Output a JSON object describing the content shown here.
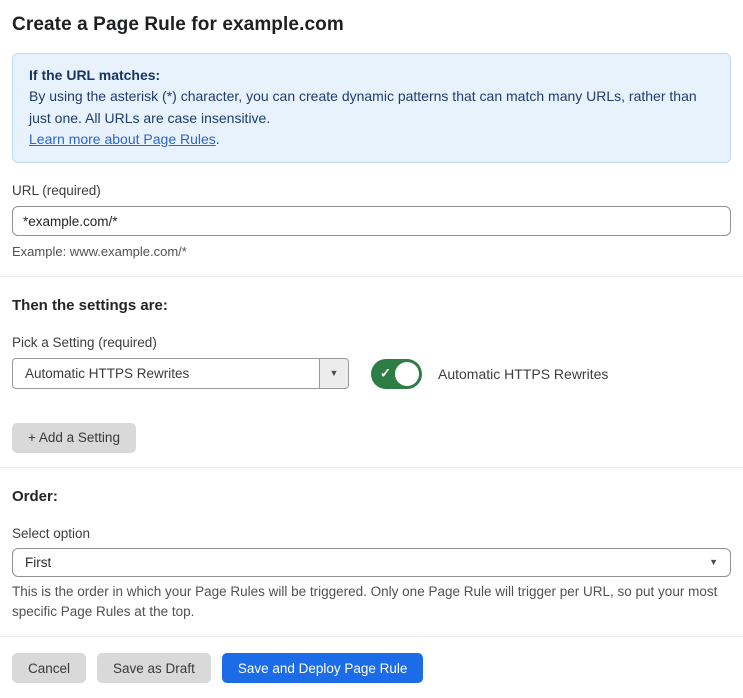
{
  "page": {
    "title": "Create a Page Rule for example.com"
  },
  "info_box": {
    "heading": "If the URL matches:",
    "body": "By using the asterisk (*) character, you can create dynamic patterns that can match many URLs, rather than just one. All URLs are case insensitive.",
    "link_text": "Learn more about Page Rules",
    "link_suffix": "."
  },
  "url_field": {
    "label": "URL (required)",
    "value": "*example.com/*",
    "helper": "Example: www.example.com/*"
  },
  "settings_section": {
    "heading": "Then the settings are:",
    "setting_label": "Pick a Setting (required)",
    "setting_value": "Automatic HTTPS Rewrites",
    "dropdown_arrow": "▼",
    "toggle_state": "on",
    "toggle_check": "✓",
    "toggle_label": "Automatic HTTPS Rewrites",
    "add_setting_label": "+ Add a Setting"
  },
  "order_section": {
    "heading": "Order:",
    "select_label": "Select option",
    "select_value": "First",
    "dropdown_arrow": "▼",
    "helper": "This is the order in which your Page Rules will be triggered. Only one Page Rule will trigger per URL, so put your most specific Page Rules at the top."
  },
  "footer": {
    "cancel_label": "Cancel",
    "save_draft_label": "Save as Draft",
    "save_deploy_label": "Save and Deploy Page Rule"
  },
  "colors": {
    "info_background": "#e8f2fc",
    "info_border": "#bfd9f5",
    "info_text": "#1e3c6e",
    "link_blue": "#2b66cc",
    "toggle_green": "#2e7d45",
    "primary_button_blue": "#1b6ce6",
    "secondary_button_gray": "#d9d9d9"
  }
}
